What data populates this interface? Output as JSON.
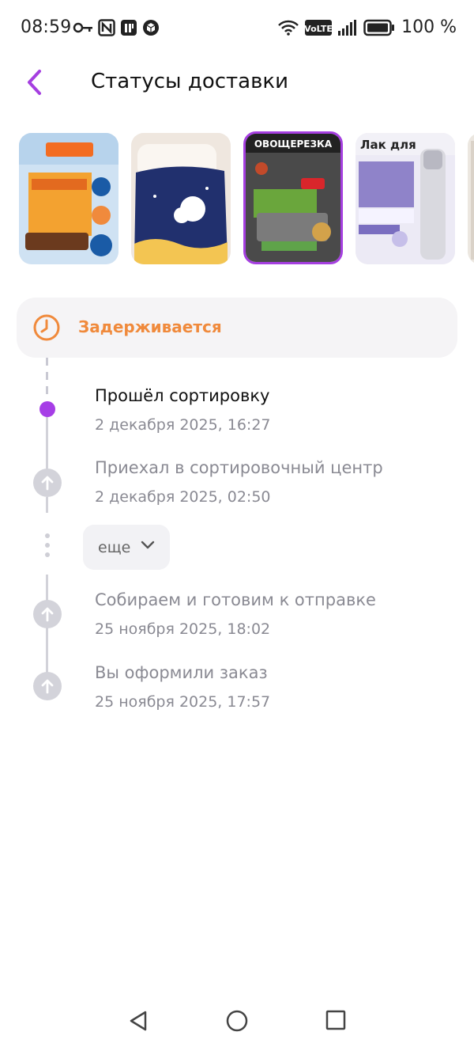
{
  "status_bar": {
    "time": "08:59",
    "network": "VoLTE",
    "battery": "100 %",
    "icons": [
      "key-icon",
      "nfc-icon",
      "app-icon",
      "box-icon",
      "wifi-icon",
      "volte-icon",
      "signal-icon",
      "battery-icon"
    ]
  },
  "header": {
    "title": "Статусы доставки",
    "back_icon": "chevron-left-icon"
  },
  "products": [
    {
      "name": "qvinto-dessert-product",
      "selected": false
    },
    {
      "name": "blanket-product",
      "selected": false
    },
    {
      "name": "vegetable-slicer-product",
      "selected": true
    },
    {
      "name": "hairspray-product",
      "selected": false
    }
  ],
  "status": {
    "label": "Задерживается",
    "icon": "clock-icon",
    "color": "#f08a3c"
  },
  "timeline": [
    {
      "title": "Прошёл сортировку",
      "date": "2 декабря 2025, 16:27",
      "active": true
    },
    {
      "title": "Приехал в сортировочный центр",
      "date": "2 декабря 2025, 02:50",
      "active": false
    },
    {
      "title": "Собираем и готовим к отправке",
      "date": "25 ноября 2025, 18:02",
      "active": false
    },
    {
      "title": "Вы оформили заказ",
      "date": "25 ноября 2025, 17:57",
      "active": false
    }
  ],
  "more_button": {
    "label": "еще"
  },
  "colors": {
    "accent": "#a53fe0",
    "delay": "#f08a3c",
    "muted": "#8a8a93"
  },
  "nav": [
    "back-nav-icon",
    "home-nav-icon",
    "recents-nav-icon"
  ]
}
